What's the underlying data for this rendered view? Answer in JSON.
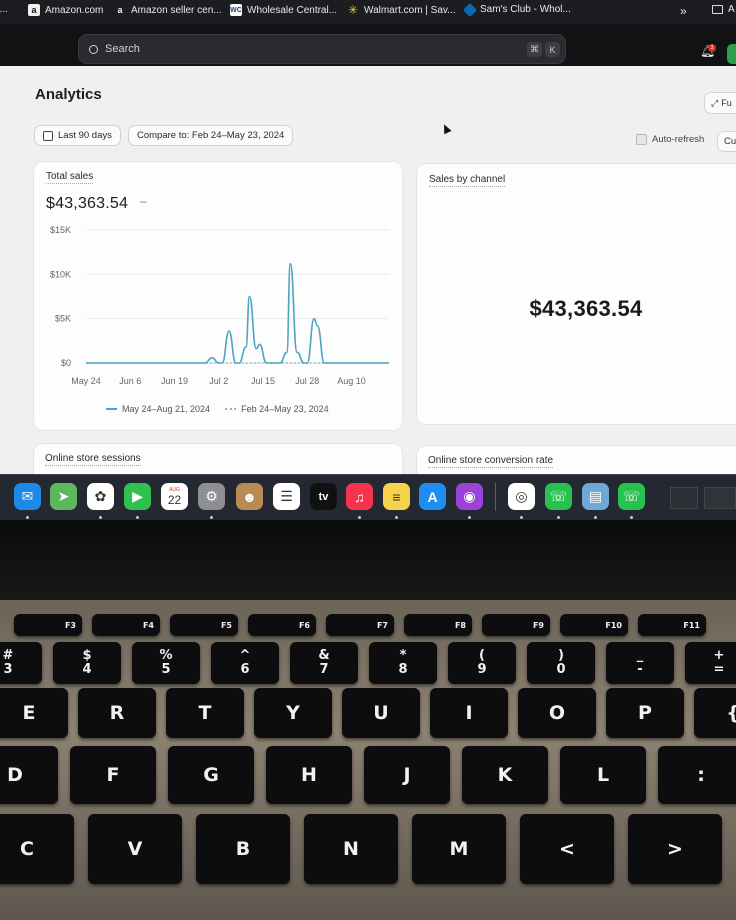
{
  "bookmarks": [
    {
      "icon": "amazon-icon",
      "glyph": "a",
      "label": "Amazon.com"
    },
    {
      "icon": "amazon-icon",
      "glyph": "a",
      "label": "Amazon seller cen..."
    },
    {
      "icon": "wholesale-central-icon",
      "glyph": "WC",
      "label": "Wholesale Central..."
    },
    {
      "icon": "walmart-icon",
      "glyph": "✳",
      "label": "Walmart.com | Sav..."
    },
    {
      "icon": "sams-club-icon",
      "glyph": "◆",
      "label": "Sam's Club - Whol..."
    }
  ],
  "bookmarks_overflow": "»",
  "bookmarks_folder_label": "A",
  "search": {
    "placeholder": "Search",
    "shortcut_cmd": "⌘",
    "shortcut_key": "K"
  },
  "notifications": {
    "count": "3"
  },
  "page": {
    "title": "Analytics",
    "full_screen_label": "Fu",
    "date_range_label": "Last 90 days",
    "compare_label": "Compare to: Feb 24–May 23, 2024",
    "auto_refresh_label": "Auto-refresh",
    "customize_label": "Cu"
  },
  "total_sales_card": {
    "title": "Total sales",
    "value": "$43,363.54",
    "change": "–",
    "legend_current": "May 24–Aug 21, 2024",
    "legend_previous": "Feb 24–May 23, 2024"
  },
  "sales_by_channel_card": {
    "title": "Sales by channel",
    "value": "$43,363.54"
  },
  "sessions_card": {
    "title": "Online store sessions"
  },
  "conversion_card": {
    "title": "Online store conversion rate"
  },
  "chart_data": {
    "type": "line",
    "title": "Total sales",
    "xlabel": "",
    "ylabel": "",
    "ylim": [
      0,
      15000
    ],
    "y_ticks": [
      "$15K",
      "$10K",
      "$5K",
      "$0"
    ],
    "x_tick_labels": [
      "May 24",
      "Jun 6",
      "Jun 19",
      "Jul 2",
      "Jul 15",
      "Jul 28",
      "Aug 10"
    ],
    "series": [
      {
        "name": "May 24–Aug 21, 2024",
        "color": "#4ea3c3",
        "x": [
          "May 24",
          "Jun 6",
          "Jun 19",
          "Jun 28",
          "Jun 30",
          "Jul 2",
          "Jul 3",
          "Jul 5",
          "Jul 7",
          "Jul 8",
          "Jul 10",
          "Jul 11",
          "Jul 13",
          "Jul 14",
          "Jul 16",
          "Jul 18",
          "Jul 20",
          "Jul 22",
          "Jul 23",
          "Jul 25",
          "Jul 27",
          "Jul 28",
          "Jul 30",
          "Jul 31",
          "Aug 2",
          "Aug 4",
          "Aug 10",
          "Aug 21"
        ],
        "y": [
          0,
          0,
          0,
          0,
          600,
          0,
          0,
          3600,
          0,
          0,
          1800,
          7500,
          1600,
          2100,
          0,
          0,
          0,
          1200,
          11200,
          1200,
          0,
          0,
          5000,
          4200,
          0,
          0,
          0,
          0
        ]
      },
      {
        "name": "Feb 24–May 23, 2024",
        "color": "#8ab6c7",
        "x": [
          "May 24",
          "Aug 21"
        ],
        "y": [
          0,
          0
        ]
      }
    ],
    "grid": true,
    "legend": "bottom"
  },
  "dock_apps": [
    {
      "name": "mail-icon",
      "color": "#1e88e5",
      "glyph": "✉"
    },
    {
      "name": "maps-icon",
      "color": "#5cb85c",
      "glyph": "➤"
    },
    {
      "name": "photos-icon",
      "color": "#ffffff",
      "glyph": "✿"
    },
    {
      "name": "facetime-icon",
      "color": "#2fc14e",
      "glyph": "▶"
    },
    {
      "name": "calendar-icon",
      "color": "#ffffff",
      "glyph": "22",
      "sub": "AUG"
    },
    {
      "name": "system-settings-icon",
      "color": "#8e8e93",
      "glyph": "⚙"
    },
    {
      "name": "contacts-icon",
      "color": "#b98a52",
      "glyph": "☻"
    },
    {
      "name": "reminders-icon",
      "color": "#ffffff",
      "glyph": "☰"
    },
    {
      "name": "apple-tv-icon",
      "color": "#111111",
      "glyph": "tv"
    },
    {
      "name": "music-icon",
      "color": "#f5334d",
      "glyph": "♫"
    },
    {
      "name": "notes-icon",
      "color": "#f7d24b",
      "glyph": "≡"
    },
    {
      "name": "app-store-icon",
      "color": "#1f8cf0",
      "glyph": "A"
    },
    {
      "name": "podcasts-icon",
      "color": "#9b43d8",
      "glyph": "◉"
    },
    {
      "name": "chrome-icon",
      "color": "#ffffff",
      "glyph": "◎"
    },
    {
      "name": "whatsapp-icon",
      "color": "#26c14f",
      "glyph": "☏"
    },
    {
      "name": "preview-icon",
      "color": "#6fa7d8",
      "glyph": "▤"
    },
    {
      "name": "whatsapp-icon",
      "color": "#26c14f",
      "glyph": "☏"
    }
  ],
  "keyboard": {
    "fn_row": [
      "F3",
      "F4",
      "F5",
      "F6",
      "F7",
      "F8",
      "F9",
      "F10",
      "F11"
    ],
    "number_row": [
      {
        "top": "#",
        "bottom": "3"
      },
      {
        "top": "$",
        "bottom": "4"
      },
      {
        "top": "%",
        "bottom": "5"
      },
      {
        "top": "^",
        "bottom": "6"
      },
      {
        "top": "&",
        "bottom": "7"
      },
      {
        "top": "*",
        "bottom": "8"
      },
      {
        "top": "(",
        "bottom": "9"
      },
      {
        "top": ")",
        "bottom": "0"
      },
      {
        "top": "_",
        "bottom": "-"
      },
      {
        "top": "+",
        "bottom": "="
      }
    ],
    "row_qwerty": [
      "E",
      "R",
      "T",
      "Y",
      "U",
      "I",
      "O",
      "P",
      "{"
    ],
    "row_home": [
      "D",
      "F",
      "G",
      "H",
      "J",
      "K",
      "L",
      ":"
    ],
    "row_bottom": [
      "C",
      "V",
      "B",
      "N",
      "M",
      "<",
      ">"
    ]
  }
}
